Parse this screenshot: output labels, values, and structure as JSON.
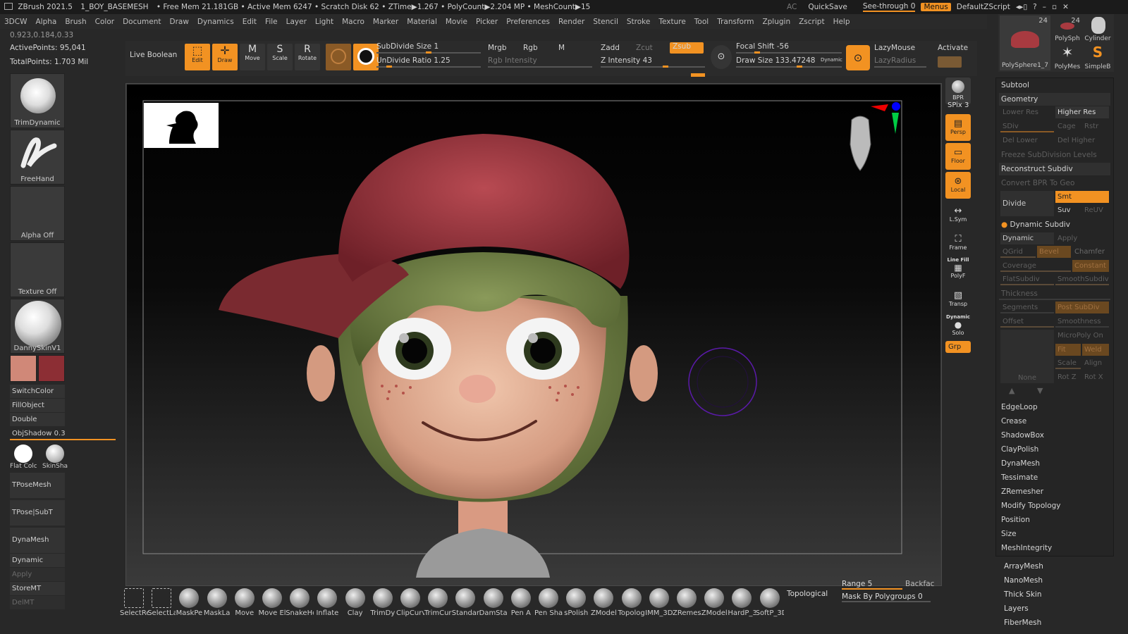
{
  "titlebar": {
    "app": "ZBrush 2021.5",
    "file": "1_BOY_BASEMESH",
    "stats": "• Free Mem 21.181GB • Active Mem 6247 • Scratch Disk 62 • ZTime▶1.267 • PolyCount▶2.204 MP • MeshCount▶15",
    "ac": "AC",
    "quicksave": "QuickSave",
    "seethrough": "See-through",
    "seethrough_value": "0",
    "menus": "Menus",
    "script": "DefaultZScript"
  },
  "menubar": [
    "3DCW",
    "Alpha",
    "Brush",
    "Color",
    "Document",
    "Draw",
    "Dynamics",
    "Edit",
    "File",
    "Layer",
    "Light",
    "Macro",
    "Marker",
    "Material",
    "Movie",
    "Picker",
    "Preferences",
    "Render",
    "Stencil",
    "Stroke",
    "Texture",
    "Tool",
    "Transform",
    "Zplugin",
    "Zscript",
    "Help"
  ],
  "leftinfo": {
    "coords": "0.923,0.184,0.33",
    "active_points": "ActivePoints: 95,041",
    "total_points": "TotalPoints: 1.703 Mil"
  },
  "leftpanel": {
    "brush": "TrimDynamic",
    "stroke": "FreeHand",
    "alpha": "Alpha Off",
    "texture": "Texture Off",
    "material": "DannySkinV1",
    "switch_color": "SwitchColor",
    "fill_object": "FillObject",
    "double": "Double",
    "obj_shadow": "ObjShadow",
    "obj_shadow_value": "0.3",
    "flat_color": "Flat Colc",
    "skin_shade": "SkinSha",
    "tpose_mesh": "TPoseMesh",
    "tpose_subt": "TPose|SubT",
    "dynamesh": "DynaMesh",
    "dynamic": "Dynamic",
    "apply": "Apply",
    "store_mt": "StoreMT",
    "del_mt": "DelMT"
  },
  "colors": {
    "primary": "#d08878",
    "secondary": "#8c2e34",
    "accent": "#f29222"
  },
  "toolbar": {
    "live_boolean": "Live Boolean",
    "edit": "Edit",
    "draw": "Draw",
    "move": "Move",
    "scale": "Scale",
    "rotate": "Rotate",
    "subdivide_size": "SubDivide Size",
    "subdivide_value": "1",
    "undivide_ratio": "UnDivide Ratio",
    "undivide_value": "1.25",
    "mrgb": "Mrgb",
    "rgb": "Rgb",
    "m": "M",
    "rgb_intensity": "Rgb Intensity",
    "zadd": "Zadd",
    "zcut": "Zcut",
    "zsub": "Zsub",
    "z_intensity": "Z Intensity",
    "z_intensity_value": "43",
    "focal_shift": "Focal Shift",
    "focal_shift_value": "-56",
    "draw_size": "Draw Size",
    "draw_size_value": "133.47248",
    "dynamic": "Dynamic",
    "lazymouse": "LazyMouse",
    "lazyradius": "LazyRadius",
    "activate": "Activate"
  },
  "rightstrip": {
    "bpr": "BPR",
    "spix": "SPix",
    "spix_value": "3",
    "persp": "Persp",
    "floor": "Floor",
    "local": "Local",
    "lsym": "L.Sym",
    "frame": "Frame",
    "line_fill": "Line Fill",
    "polyf": "PolyF",
    "transp": "Transp",
    "dynamic": "Dynamic",
    "solo": "Solo",
    "grp": "Grp"
  },
  "subtools": {
    "count_a": "24",
    "count_b": "24",
    "item_polysphere": "PolySphere1_7",
    "item_polysph": "PolySph",
    "item_cylinder": "Cylinder",
    "item_polymesh": "PolyMes",
    "item_simple": "SimpleB"
  },
  "rightpanel": {
    "subtool": "Subtool",
    "geometry": "Geometry",
    "lower_res": "Lower Res",
    "higher_res": "Higher Res",
    "sdiv": "SDiv",
    "cage": "Cage",
    "rstr": "Rstr",
    "del_lower": "Del Lower",
    "del_higher": "Del Higher",
    "freeze": "Freeze SubDivision Levels",
    "reconstruct": "Reconstruct Subdiv",
    "convert_bpr": "Convert BPR To Geo",
    "divide": "Divide",
    "smt": "Smt",
    "suv": "Suv",
    "reuv": "ReUV",
    "dynamic_subdiv": "Dynamic Subdiv",
    "dynamic": "Dynamic",
    "apply": "Apply",
    "qgrid": "QGrid",
    "bevel": "Bevel",
    "chamfer": "Chamfer",
    "coverage": "Coverage",
    "constant": "Constant",
    "flatsubdiv": "FlatSubdiv",
    "smoothsubdiv": "SmoothSubdiv",
    "thickness": "Thickness",
    "segments": "Segments",
    "post_subdiv": "Post SubDiv",
    "offset": "Offset",
    "smoothness": "Smoothness",
    "micropoly_on": "MicroPoly On",
    "fit": "Fit",
    "weld": "Weld",
    "scale": "Scale",
    "align": "Align",
    "none": "None",
    "rot_z": "Rot Z",
    "rot_x": "Rot X",
    "edgeloop": "EdgeLoop",
    "crease": "Crease",
    "shadowbox": "ShadowBox",
    "claypolish": "ClayPolish",
    "dynamesh": "DynaMesh",
    "tessimate": "Tessimate",
    "zremesher": "ZRemesher",
    "modify_topology": "Modify Topology",
    "position": "Position",
    "size": "Size",
    "meshintegrity": "MeshIntegrity"
  },
  "rightbottom": [
    "ArrayMesh",
    "NanoMesh",
    "Thick Skin",
    "Layers",
    "FiberMesh"
  ],
  "bottombar": {
    "brushes": [
      "SelectRe",
      "SelectLa",
      "MaskPe",
      "MaskLa",
      "Move",
      "Move El",
      "SnakeHo",
      "Inflate",
      "Clay",
      "TrimDy",
      "ClipCurv",
      "TrimCur",
      "Standar",
      "DamSta",
      "Pen A",
      "Pen Sha",
      "sPolish",
      "ZModel",
      "Topolog",
      "IMM_3D",
      "ZRemes",
      "ZModel",
      "HardP_3",
      "SoftP_3D"
    ],
    "topological": "Topological",
    "range": "Range",
    "range_value": "5",
    "backface": "Backfac",
    "mask_by_polygroups": "Mask By Polygroups",
    "mask_value": "0"
  }
}
